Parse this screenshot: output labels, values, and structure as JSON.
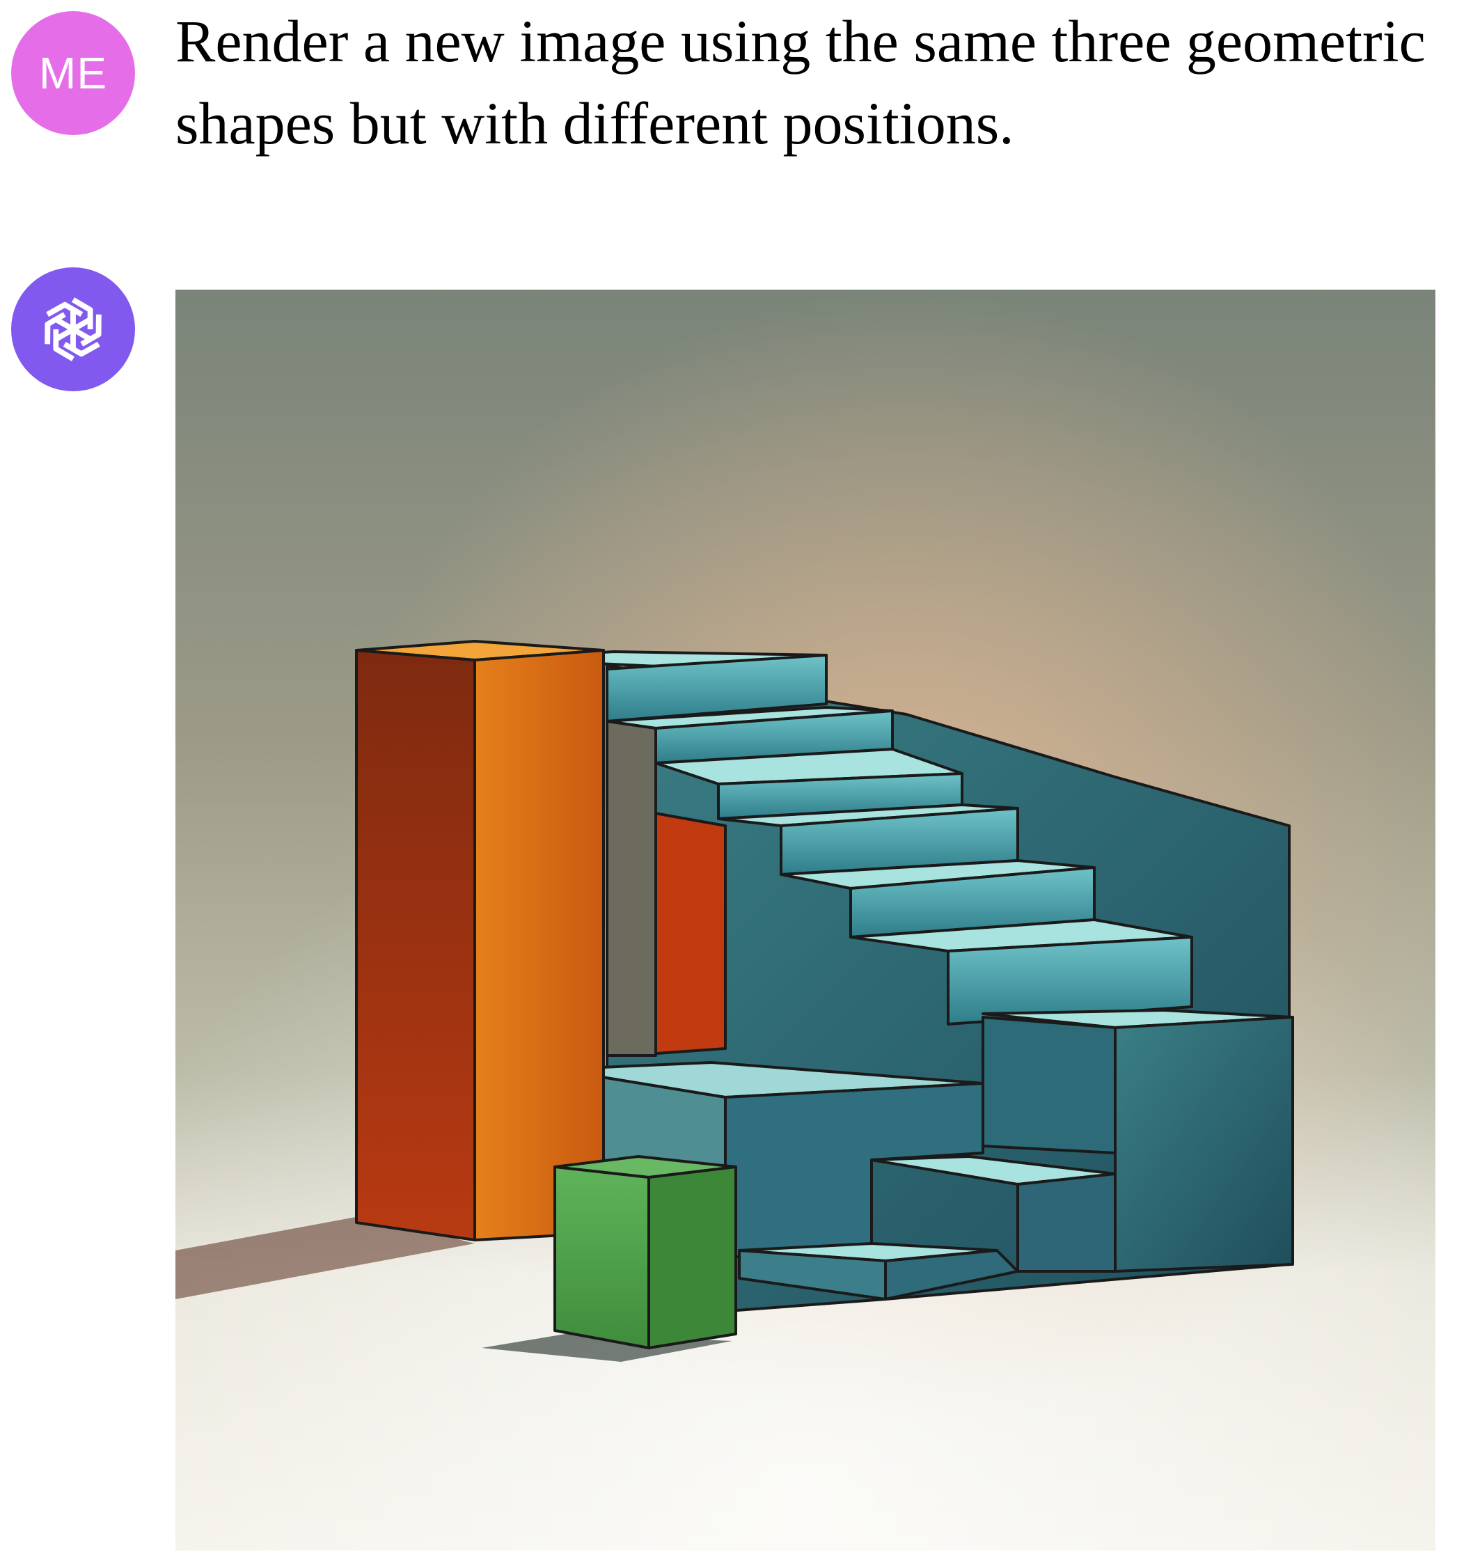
{
  "conversation": {
    "user": {
      "avatar_label": "ME",
      "avatar_color": "#e56ee8",
      "prompt": "Render a new image using the same three geometric shapes but with different positions."
    },
    "assistant": {
      "avatar_icon": "openai-logo-icon",
      "avatar_color": "#8159ee",
      "image": {
        "subject": "orange-tall-box, teal-staircase, green-cube",
        "colors": {
          "orange_box": "#e07a17",
          "teal_stairs": "#5fb8c0",
          "green_cube": "#4fa24d",
          "red_inset": "#c63a10"
        }
      }
    }
  }
}
